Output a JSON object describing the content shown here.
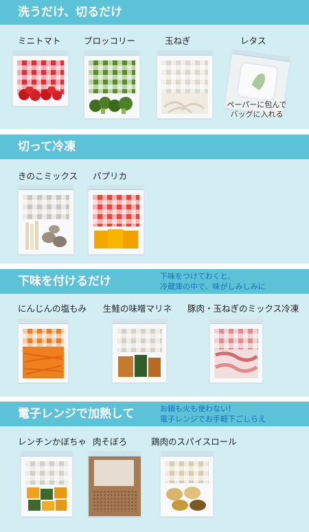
{
  "sections": [
    {
      "title": "洗うだけ、切るだけ",
      "items": [
        "ミニトマト",
        "ブロッコリー",
        "玉ねぎ",
        "レタス"
      ],
      "callout": [
        "ペーパーに包んで",
        "バッグに入れる"
      ]
    },
    {
      "title": "切って冷凍",
      "items": [
        "きのこミックス",
        "パプリカ"
      ]
    },
    {
      "title": "下味を付けるだけ",
      "note": [
        "下味をつけておくと、",
        "冷蔵庫の中で、味がしみしみに"
      ],
      "items": [
        "にんじんの塩もみ",
        "生鮭の味噌マリネ",
        "豚肉・玉ねぎのミックス冷凍"
      ]
    },
    {
      "title": "電子レンジで加熱して",
      "note": [
        "お鍋も火も使わない！",
        "電子レンジでお手軽下ごしらえ"
      ],
      "items": [
        "レンチンかぼちゃ",
        "肉そぼろ",
        "鶏肉のスパイスロール"
      ]
    }
  ],
  "colors": {
    "banner": "#5cc2d8",
    "panel": "#d3eef3",
    "note_text": "#1b6fb4"
  }
}
